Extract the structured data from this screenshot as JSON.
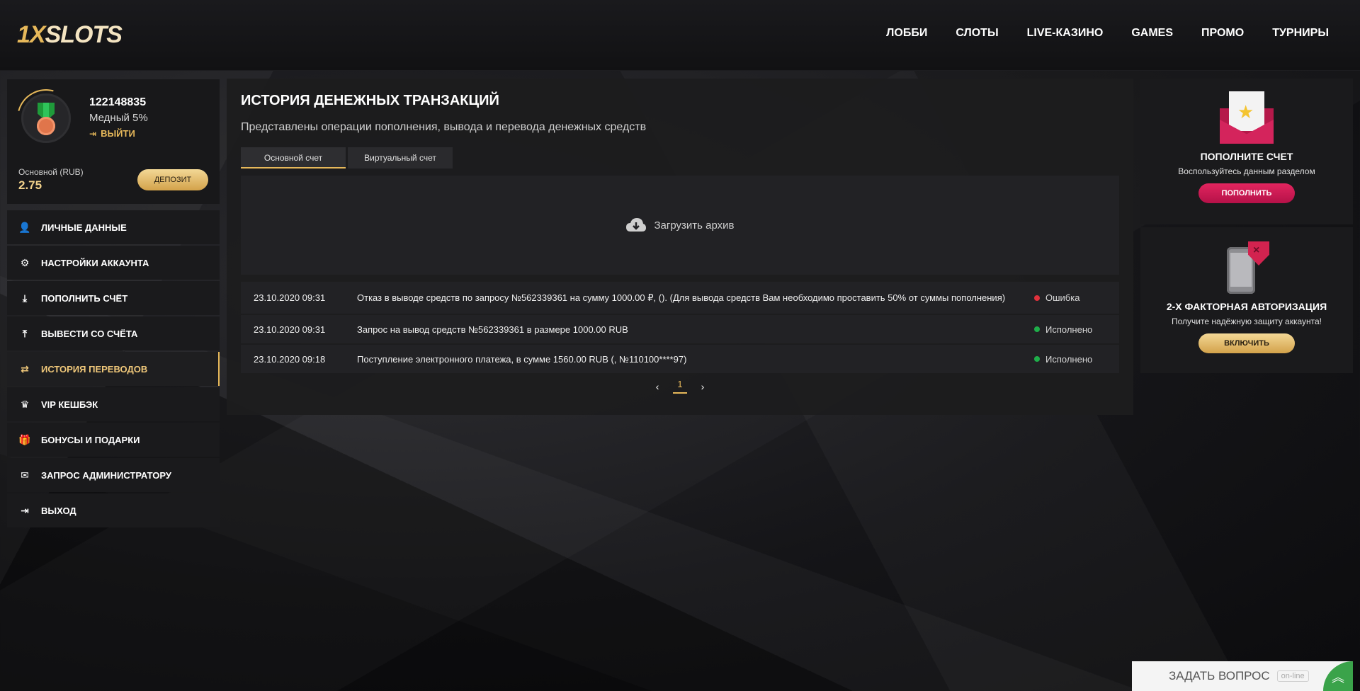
{
  "header": {
    "logo": {
      "part1": "1X",
      "part2": "SLOTS"
    },
    "nav": [
      "ЛОББИ",
      "СЛОТЫ",
      "LIVE-КАЗИНО",
      "GAMES",
      "ПРОМО",
      "ТУРНИРЫ"
    ]
  },
  "profile": {
    "id": "122148835",
    "level": "Медный 5%",
    "logout": "ВЫЙТИ",
    "balance_label": "Основной (RUB)",
    "balance_value": "2.75",
    "deposit_btn": "ДЕПОЗИТ"
  },
  "menu": [
    {
      "label": "ЛИЧНЫЕ ДАННЫЕ",
      "icon": "user-plus-icon"
    },
    {
      "label": "НАСТРОЙКИ АККАУНТА",
      "icon": "gears-icon"
    },
    {
      "label": "ПОПОЛНИТЬ СЧЁТ",
      "icon": "download-icon"
    },
    {
      "label": "ВЫВЕСТИ СО СЧЁТА",
      "icon": "upload-icon"
    },
    {
      "label": "ИСТОРИЯ ПЕРЕВОДОВ",
      "icon": "exchange-icon",
      "active": true
    },
    {
      "label": "VIP КЕШБЭК",
      "icon": "crown-icon"
    },
    {
      "label": "БОНУСЫ И ПОДАРКИ",
      "icon": "gift-icon"
    },
    {
      "label": "ЗАПРОС АДМИНИСТРАТОРУ",
      "icon": "envelope-icon"
    },
    {
      "label": "ВЫХОД",
      "icon": "sign-out-icon"
    }
  ],
  "main": {
    "title": "ИСТОРИЯ ДЕНЕЖНЫХ ТРАНЗАКЦИЙ",
    "subtitle": "Представлены операции пополнения, вывода и перевода денежных средств",
    "tabs": [
      "Основной счет",
      "Виртуальный счет"
    ],
    "archive_label": "Загрузить архив",
    "transactions": [
      {
        "date": "23.10.2020 09:31",
        "description": "Отказ в выводе средств по запросу №562339361 на сумму 1000.00 ₽, (). (Для вывода средств Вам необходимо проставить 50% от суммы пополнения)",
        "status": "Ошибка",
        "status_color": "#e0313c"
      },
      {
        "date": "23.10.2020 09:31",
        "description": "Запрос на вывод средств №562339361 в размере 1000.00 RUB",
        "status": "Исполнено",
        "status_color": "#1fae4a"
      },
      {
        "date": "23.10.2020 09:18",
        "description": "Поступление электронного платежа, в сумме 1560.00 RUB (, №110100****97)",
        "status": "Исполнено",
        "status_color": "#1fae4a"
      }
    ],
    "pager": {
      "current": "1"
    }
  },
  "cards": {
    "deposit": {
      "title": "ПОПОЛНИТЕ СЧЕТ",
      "desc": "Воспользуйтесь данным разделом",
      "btn": "ПОПОЛНИТЬ"
    },
    "twofa": {
      "title": "2-Х ФАКТОРНАЯ АВТОРИЗАЦИЯ",
      "desc": "Получите надёжную защиту аккаунта!",
      "btn": "ВКЛЮЧИТЬ"
    }
  },
  "chat": {
    "label": "ЗАДАТЬ ВОПРОС",
    "badge": "on-line"
  },
  "colors": {
    "accent_gold": "#e6b85a",
    "error": "#e0313c",
    "success": "#1fae4a",
    "pink": "#d4245c",
    "chat_green": "#3aa34a"
  }
}
